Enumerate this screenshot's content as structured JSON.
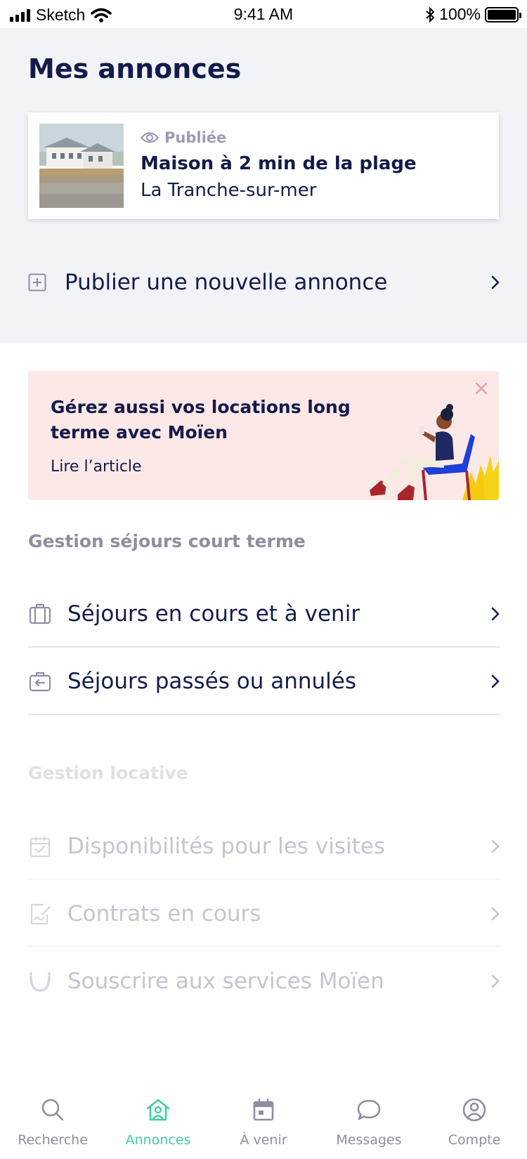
{
  "status_bar": {
    "carrier": "Sketch",
    "time": "9:41 AM",
    "battery": "100%"
  },
  "page": {
    "title": "Mes annonces"
  },
  "listing": {
    "status": "Publiée",
    "title": "Maison à 2 min de la plage",
    "location": "La Tranche-sur-mer"
  },
  "publish": {
    "label": "Publier une nouvelle annonce"
  },
  "promo": {
    "title": "Gérez aussi vos locations long terme avec Moïen",
    "link": "Lire l’article"
  },
  "short_term": {
    "header": "Gestion séjours court terme",
    "items": [
      {
        "label": "Séjours en cours et à venir",
        "icon": "suitcase-icon"
      },
      {
        "label": "Séjours passés ou annulés",
        "icon": "suitcase-return-icon"
      }
    ]
  },
  "rental": {
    "header": "Gestion locative",
    "items": [
      {
        "label": "Disponibilités pour les visites",
        "icon": "calendar-check-icon"
      },
      {
        "label": "Contrats en cours",
        "icon": "contract-sign-icon"
      },
      {
        "label": "Souscrire aux services Moïen",
        "icon": "moien-logo-icon"
      }
    ]
  },
  "tabs": [
    {
      "label": "Recherche",
      "icon": "search-icon",
      "active": false
    },
    {
      "label": "Annonces",
      "icon": "house-user-icon",
      "active": true
    },
    {
      "label": "À venir",
      "icon": "calendar-icon",
      "active": false
    },
    {
      "label": "Messages",
      "icon": "chat-bubble-icon",
      "active": false
    },
    {
      "label": "Compte",
      "icon": "account-icon",
      "active": false
    }
  ],
  "colors": {
    "navy": "#131b4a",
    "accent": "#3ecfa3",
    "page_gray": "#f2f3f7",
    "promo_pink": "#fde8e8",
    "muted": "#8d8fa0",
    "disabled": "#c3c5d1"
  }
}
